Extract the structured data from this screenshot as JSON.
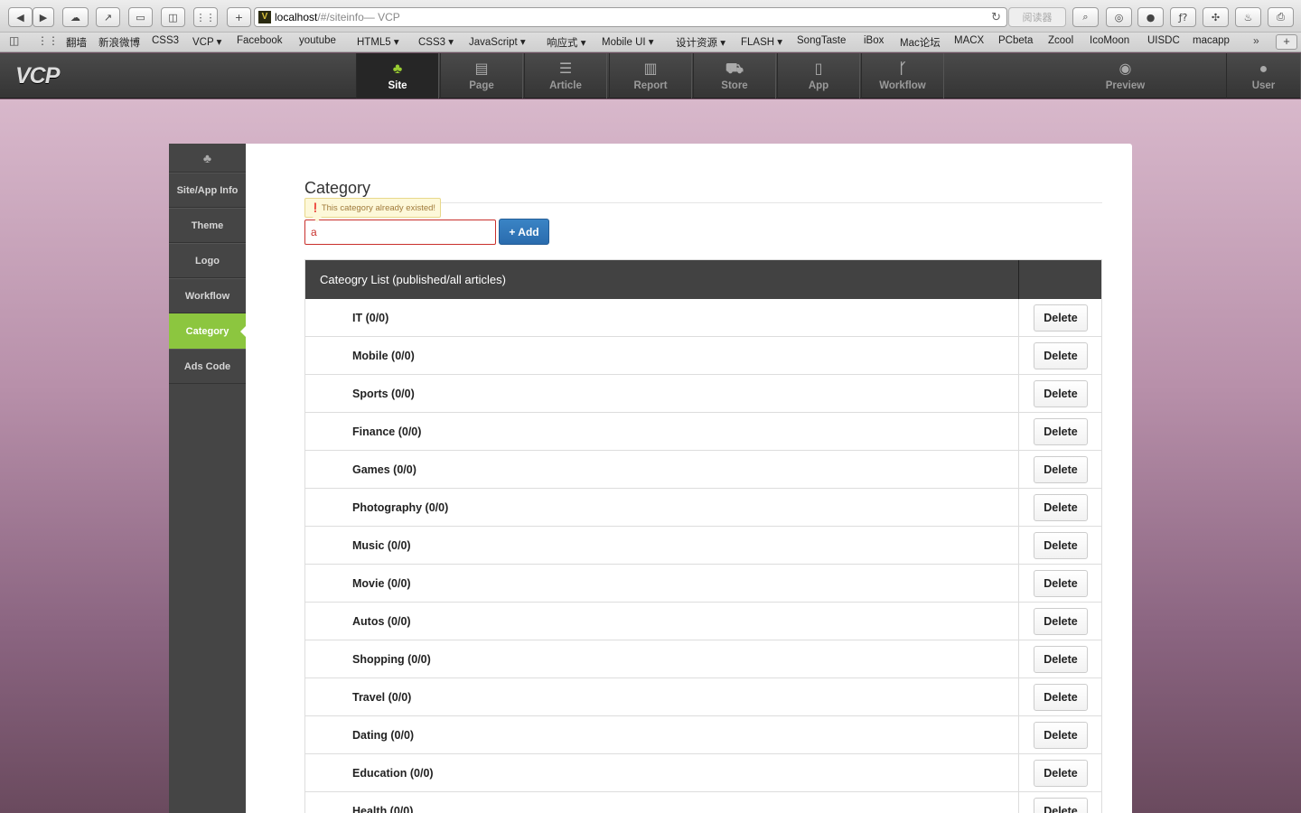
{
  "browser": {
    "url_host": "localhost",
    "url_path": "/#/siteinfo",
    "page_title": " — VCP",
    "reader_label": "阅读器"
  },
  "bookmarks": [
    "翻墙",
    "新浪微博",
    "CSS3",
    "VCP ▾",
    "Facebook",
    "youtube",
    "HTML5 ▾",
    "CSS3 ▾",
    "JavaScript ▾",
    "响应式 ▾",
    "Mobile UI ▾",
    "设计资源 ▾",
    "FLASH ▾",
    "SongTaste",
    "iBox",
    "Mac论坛",
    "MACX",
    "PCbeta",
    "Zcool",
    "IcoMoon",
    "UISDC",
    "macapp"
  ],
  "app": {
    "logo": "VCP",
    "nav": [
      {
        "label": "Site",
        "icon": "sitemap-icon",
        "glyph": "♣"
      },
      {
        "label": "Page",
        "icon": "page-icon",
        "glyph": "▤"
      },
      {
        "label": "Article",
        "icon": "list-icon",
        "glyph": "☰"
      },
      {
        "label": "Report",
        "icon": "chart-icon",
        "glyph": "▥"
      },
      {
        "label": "Store",
        "icon": "cart-icon",
        "glyph": "⛟"
      },
      {
        "label": "App",
        "icon": "phone-icon",
        "glyph": "▯"
      },
      {
        "label": "Workflow",
        "icon": "branch-icon",
        "glyph": "ᚴ"
      },
      {
        "label": "Preview",
        "icon": "eye-icon",
        "glyph": "◉"
      },
      {
        "label": "User",
        "icon": "user-icon",
        "glyph": "●"
      }
    ]
  },
  "sidebar": {
    "items": [
      "Site/App Info",
      "Theme",
      "Logo",
      "Workflow",
      "Category",
      "Ads Code"
    ],
    "active": "Category"
  },
  "content": {
    "title": "Category",
    "tooltip": "This category already existed!",
    "input_value": "a",
    "add_label": "+ Add",
    "table_header": "Cateogry List (published/all articles)",
    "delete_label": "Delete",
    "categories": [
      "IT (0/0)",
      "Mobile (0/0)",
      "Sports (0/0)",
      "Finance (0/0)",
      "Games (0/0)",
      "Photography (0/0)",
      "Music (0/0)",
      "Movie (0/0)",
      "Autos (0/0)",
      "Shopping (0/0)",
      "Travel (0/0)",
      "Dating (0/0)",
      "Education (0/0)",
      "Health (0/0)"
    ]
  },
  "colors": {
    "accent": "#8cc63f",
    "primary": "#2a6cae",
    "error": "#c9302c"
  }
}
